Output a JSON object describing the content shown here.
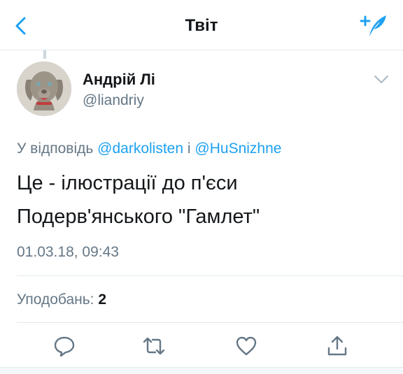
{
  "header": {
    "title": "Твіт",
    "back_icon": "chevron-left-icon",
    "compose_icon": "compose-feather-icon",
    "accent_color": "#1da1f2"
  },
  "tweet": {
    "author": {
      "name": "Андрій Лі",
      "handle": "@liandriy"
    },
    "reply": {
      "prefix": "У відповідь",
      "mention_1": "@darkolisten",
      "connector": "і",
      "mention_2": "@HuSnizhne"
    },
    "text": "Це - ілюстрації до п'єси Подерв'янського \"Гамлет\"",
    "timestamp": "01.03.18, 09:43",
    "likes_label": "Уподобань:",
    "likes_count": "2"
  },
  "actions": [
    {
      "name": "reply",
      "icon": "reply-icon"
    },
    {
      "name": "retweet",
      "icon": "retweet-icon"
    },
    {
      "name": "like",
      "icon": "heart-icon"
    },
    {
      "name": "share",
      "icon": "share-icon"
    }
  ]
}
